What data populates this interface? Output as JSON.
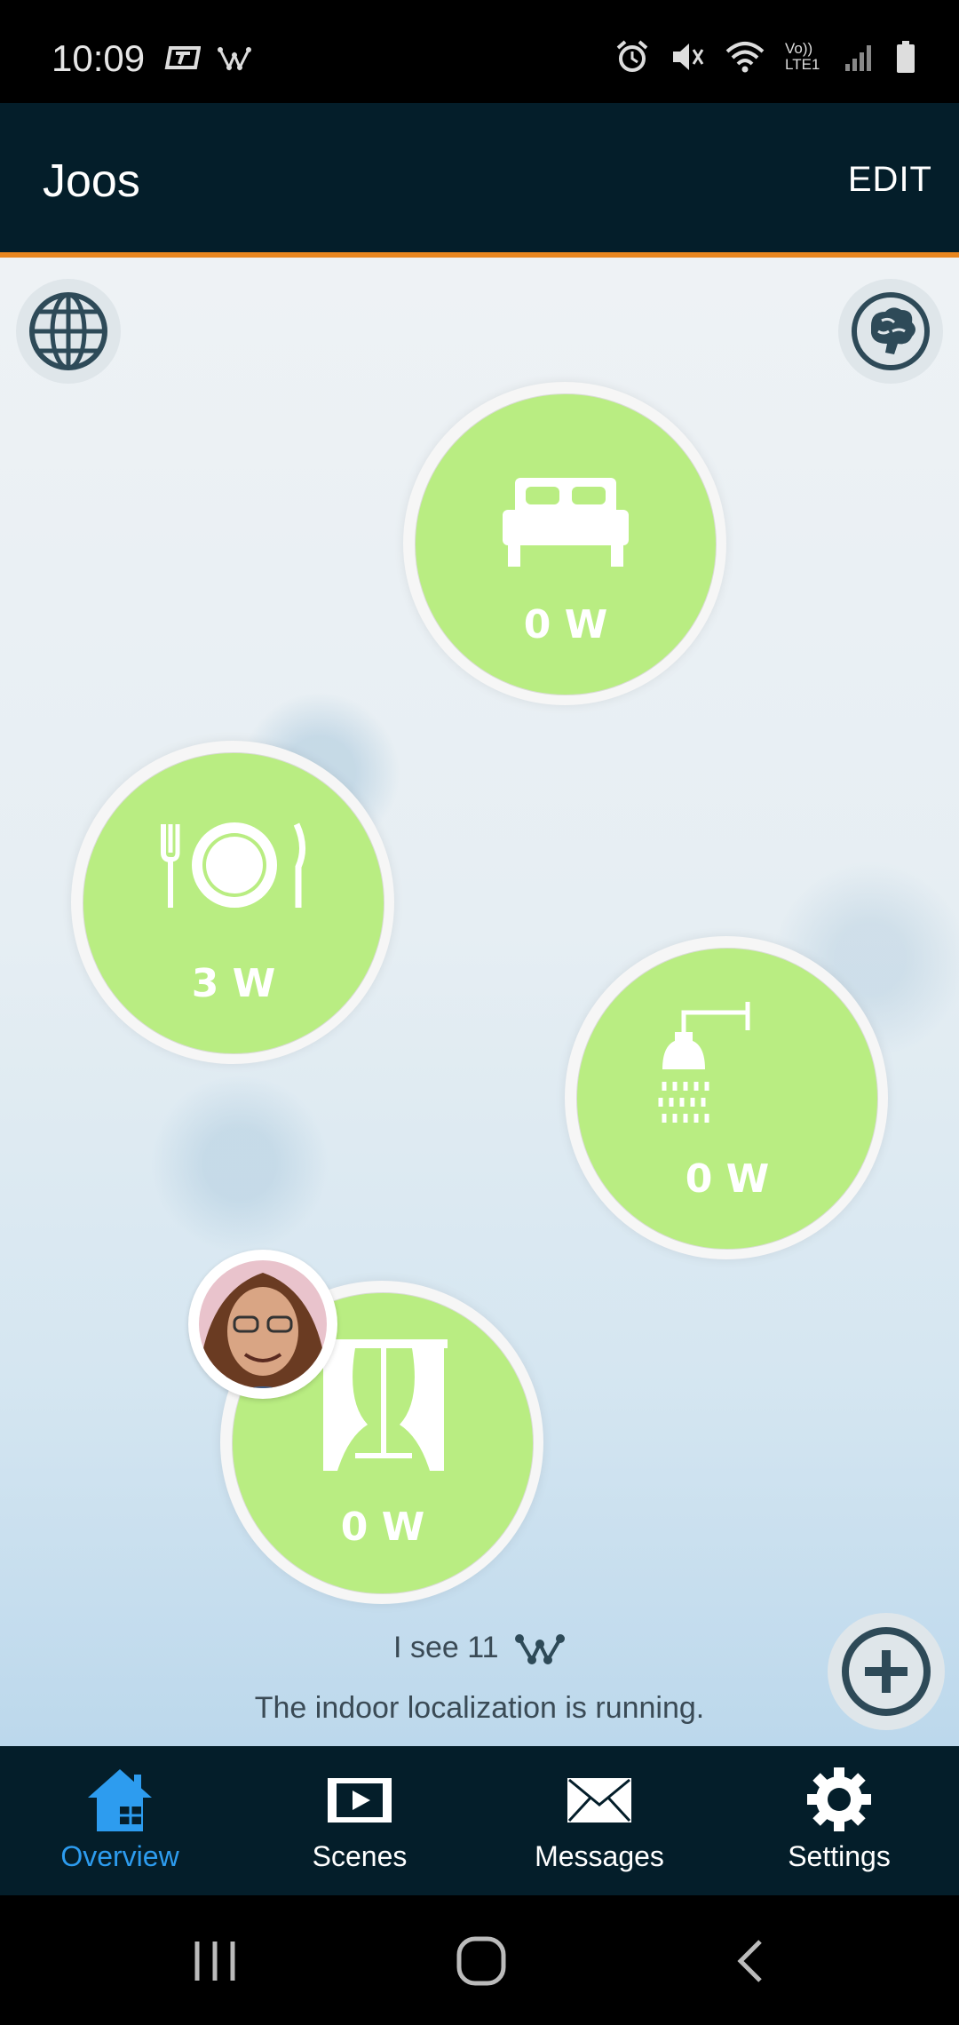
{
  "status_bar": {
    "time": "10:09",
    "left_icons": [
      "t-mobile-icon",
      "digitalstrom-icon"
    ],
    "right_icons": [
      "alarm-icon",
      "mute-icon",
      "wifi-icon",
      "volte-icon",
      "signal-icon",
      "battery-icon"
    ],
    "volte_text": "Vo)) LTE1"
  },
  "header": {
    "title": "Joos",
    "edit_label": "EDIT"
  },
  "colors": {
    "appbar": "#041e2a",
    "accent_line": "#e8861f",
    "room_green": "#b9ed82",
    "tab_active": "#2d9cef",
    "tab_inactive": "#ffffff"
  },
  "rooms": [
    {
      "icon": "bed-icon",
      "power": "0 W"
    },
    {
      "icon": "dining-icon",
      "power": "3 W"
    },
    {
      "icon": "shower-icon",
      "power": "0 W"
    },
    {
      "icon": "curtain-icon",
      "power": "0 W"
    }
  ],
  "localization": {
    "line1": "I see 11",
    "line2": "The indoor localization is running."
  },
  "tabs": [
    {
      "label": "Overview",
      "icon": "home-icon",
      "active": true
    },
    {
      "label": "Scenes",
      "icon": "scenes-icon",
      "active": false
    },
    {
      "label": "Messages",
      "icon": "envelope-icon",
      "active": false
    },
    {
      "label": "Settings",
      "icon": "gear-icon",
      "active": false
    }
  ],
  "nav_buttons": [
    "recents-icon",
    "home-circle-icon",
    "back-icon"
  ]
}
